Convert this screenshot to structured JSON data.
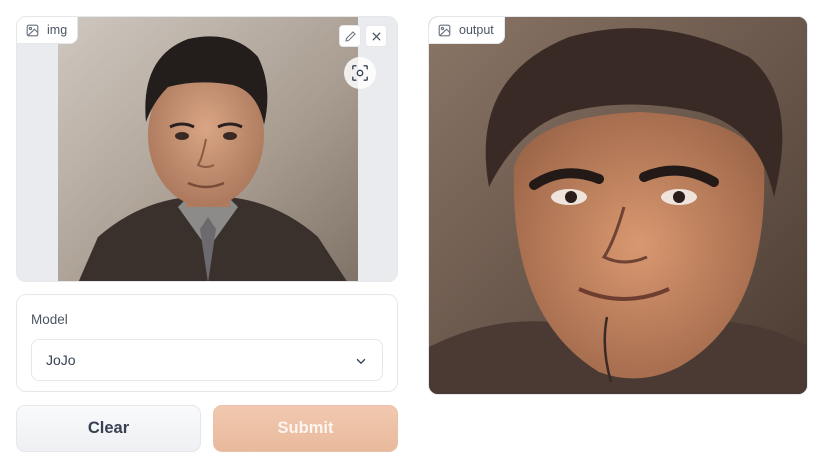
{
  "input_image": {
    "label": "img",
    "icon": "image-icon",
    "tools": {
      "edit_icon": "pencil-icon",
      "close_icon": "close-icon",
      "crop_icon": "crop-focus-icon"
    }
  },
  "output_image": {
    "label": "output",
    "icon": "image-icon"
  },
  "model": {
    "label": "Model",
    "selected": "JoJo",
    "chevron_icon": "chevron-down-icon"
  },
  "buttons": {
    "clear_label": "Clear",
    "submit_label": "Submit"
  },
  "colors": {
    "submit_bg": "#e9b99c",
    "submit_text": "#fdf5ef",
    "panel_border": "#e5e7eb"
  }
}
